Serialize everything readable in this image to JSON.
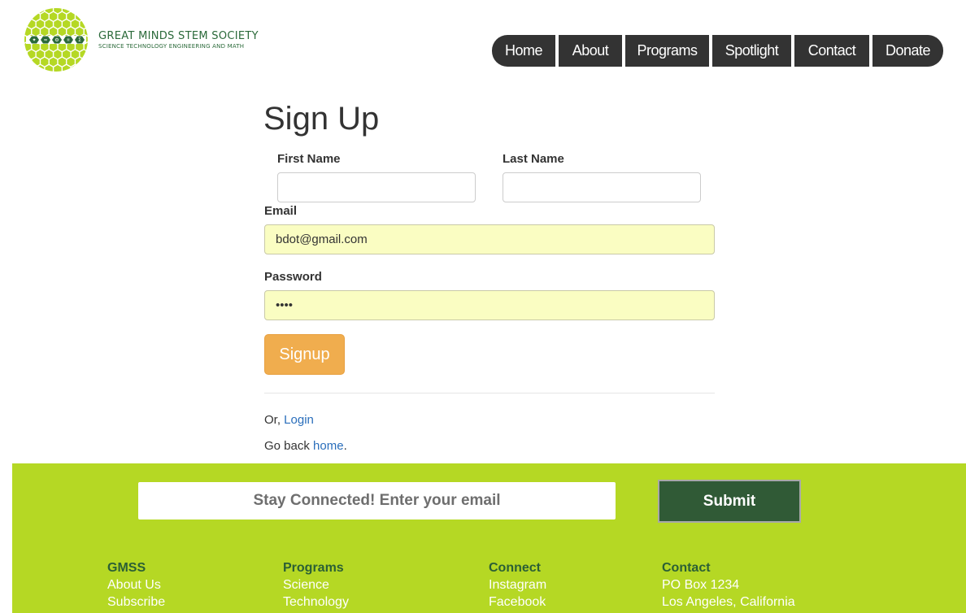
{
  "brand": {
    "title": "GREAT MINDS STEM SOCIETY",
    "subtitle": "SCIENCE TECHNOLOGY ENGINEERING AND MATH",
    "logo_icon": "hexagon-globe-logo",
    "colors": {
      "primary_green": "#b5d824",
      "dark_green": "#2b6a3a"
    }
  },
  "nav": {
    "items": [
      {
        "label": "Home"
      },
      {
        "label": "About"
      },
      {
        "label": "Programs"
      },
      {
        "label": "Spotlight"
      },
      {
        "label": "Contact"
      },
      {
        "label": "Donate"
      }
    ]
  },
  "form": {
    "title": "Sign Up",
    "first_name_label": "First Name",
    "first_name_value": "",
    "last_name_label": "Last Name",
    "last_name_value": "",
    "email_label": "Email",
    "email_value": "bdot@gmail.com",
    "password_label": "Password",
    "password_value": "••••",
    "signup_label": "Signup",
    "or_prefix": "Or, ",
    "login_link": "Login",
    "go_back_prefix": "Go back ",
    "home_link": "home",
    "go_back_suffix": "."
  },
  "footer": {
    "subscribe_placeholder": "Stay Connected! Enter your email",
    "submit_label": "Submit",
    "columns": [
      {
        "heading": "GMSS",
        "links": [
          "About Us",
          "Subscribe"
        ]
      },
      {
        "heading": "Programs",
        "links": [
          "Science",
          "Technology"
        ]
      },
      {
        "heading": "Connect",
        "links": [
          "Instagram",
          "Facebook"
        ]
      },
      {
        "heading": "Contact",
        "links": [
          "PO Box 1234",
          "Los Angeles, California"
        ]
      }
    ]
  }
}
